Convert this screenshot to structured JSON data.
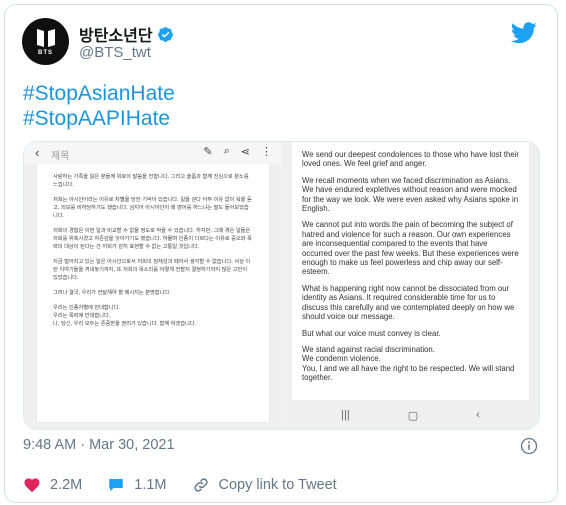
{
  "account": {
    "display_name": "방탄소년단",
    "handle": "@BTS_twt",
    "avatar_text": "BTS"
  },
  "hashtags": [
    "#StopAsianHate",
    "#StopAAPIHate"
  ],
  "media": {
    "left_panel": {
      "top_title": "제목",
      "paragraphs": [
        "사랑하는 가족을 잃은 분들께 위로의 말씀을 전합니다. 그리고 슬픔과 함께 진심으로 분노를 느낍니다.",
        "저희는 아시안이라는 이유로 차별을 당한 기억이 있습니다. 길을 걷다 아무 이유 없이 욕을 듣고, 외모를 비하당하기도 했습니다. 심지어 아시아인이 왜 영어를 하느냐는 말도 들어보았습니다.",
        "저희의 경험은 이번 일과 비교할 수 없을 정도로 작을 수 있습니다. 하지만, 그때 겪은 일들은 저희를 위축시켰고 자존감을 앗아가기도 했습니다. 하물며 인종이 다르다는 이유로 증오와 폭력의 대상이 된다는 건 저희가 감히 표현할 수 없는 고통일 것입니다.",
        "지금 벌어지고 있는 일은 아시안으로서 저희의 정체성과 떼어서 생각할 수 없습니다. 서상 이런 이야기들을 꺼내놓기까지, 또 저희의 목소리를 어떻게 전할지 결정하기까지 많은 고민이 있었습니다.",
        "그러나 결국, 우리가 전달해야 할 메시지는 분명합니다.",
        "우리는 인종차별에 반대합니다.\n우리는 폭력에 반대합니다.\n나, 당신, 우리 모두는 존중받을 권리가 있습니다. 함께 하겠습니다."
      ]
    },
    "right_panel": {
      "paragraphs": [
        "We send our deepest condolences to those who have lost their loved ones. We feel grief and anger.",
        "We recall moments when we faced discrimination as Asians. We have endured expletives without reason and were mocked for the way we look. We were even asked why Asians spoke in English.",
        "We cannot put into words the pain of becoming the subject of hatred and violence for such a reason. Our own experiences are inconsequential compared to the events that have occurred over the past few weeks. But these experiences were enough to make us feel powerless and chip away our self-esteem.",
        "What is happening right now cannot be dissociated from our identity as Asians. It required considerable time for us to discuss this carefully and we contemplated deeply on how we should voice our message.",
        "But what our voice must convey is clear.",
        "We stand against racial discrimination.\nWe condemn violence.\nYou, I and we all have the right to be respected. We will stand together."
      ]
    }
  },
  "timestamp": "9:48 AM · Mar 30, 2021",
  "actions": {
    "likes": "2.2M",
    "replies": "1.1M",
    "copy_link": "Copy link to Tweet"
  },
  "colors": {
    "link": "#1b95e0",
    "muted": "#657786",
    "verified": "#1da1f2",
    "like": "#e0245e"
  }
}
